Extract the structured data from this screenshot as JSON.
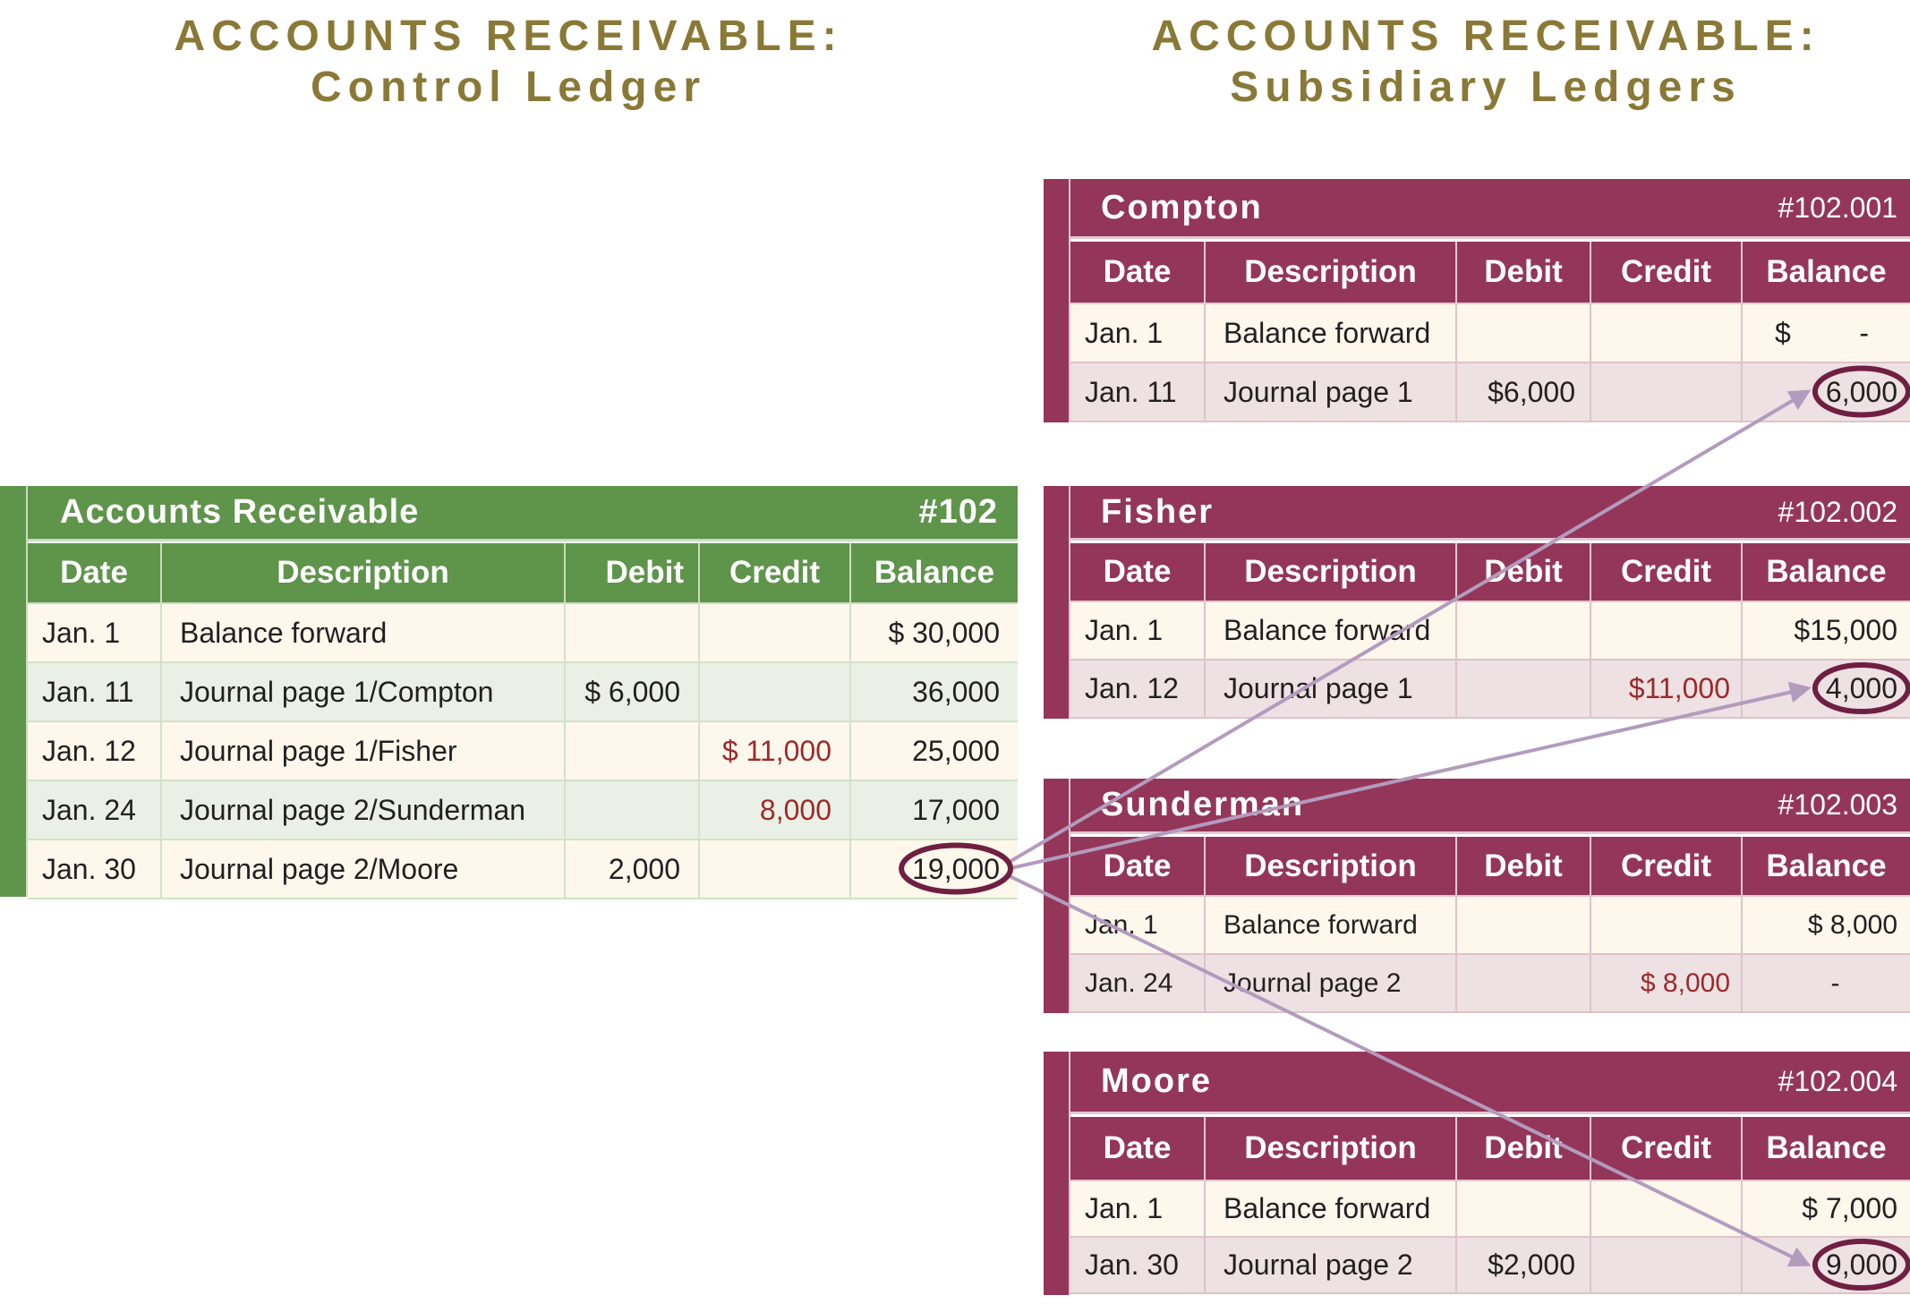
{
  "titles": {
    "control": {
      "line1": "ACCOUNTS RECEIVABLE:",
      "line2": "Control Ledger"
    },
    "subsidiary": {
      "line1": "ACCOUNTS RECEIVABLE:",
      "line2": "Subsidiary Ledgers"
    }
  },
  "columns": [
    "Date",
    "Description",
    "Debit",
    "Credit",
    "Balance"
  ],
  "colors": {
    "title": "#8a7936",
    "control_header": "#5f944b",
    "subsidiary_header": "#93365a",
    "credit_text": "#9b2a2a",
    "highlight_oval": "#6f1f42",
    "connector_arrow": "#b39bbd"
  },
  "control_ledger": {
    "name": "Accounts Receivable",
    "account": "#102",
    "rows": [
      {
        "date": "Jan. 1",
        "description": "Balance forward",
        "debit": "",
        "credit": "",
        "balance": "$  30,000"
      },
      {
        "date": "Jan. 11",
        "description": "Journal page 1/Compton",
        "debit": "$  6,000",
        "credit": "",
        "balance": "36,000"
      },
      {
        "date": "Jan. 12",
        "description": "Journal page 1/Fisher",
        "debit": "",
        "credit": "$  11,000",
        "balance": "25,000"
      },
      {
        "date": "Jan. 24",
        "description": "Journal page 2/Sunderman",
        "debit": "",
        "credit": "8,000",
        "balance": "17,000"
      },
      {
        "date": "Jan. 30",
        "description": "Journal page 2/Moore",
        "debit": "2,000",
        "credit": "",
        "balance": "19,000",
        "highlighted": true
      }
    ]
  },
  "subsidiary_ledgers": [
    {
      "name": "Compton",
      "account": "#102.001",
      "rows": [
        {
          "date": "Jan. 1",
          "description": "Balance forward",
          "debit": "",
          "credit": "",
          "balance_symbol": "$",
          "balance": "-"
        },
        {
          "date": "Jan. 11",
          "description": "Journal page 1",
          "debit": "$6,000",
          "credit": "",
          "balance": "6,000",
          "highlighted": true
        }
      ]
    },
    {
      "name": "Fisher",
      "account": "#102.002",
      "rows": [
        {
          "date": "Jan. 1",
          "description": "Balance forward",
          "debit": "",
          "credit": "",
          "balance": "$15,000"
        },
        {
          "date": "Jan. 12",
          "description": "Journal page 1",
          "debit": "",
          "credit": "$11,000",
          "balance": "4,000",
          "highlighted": true
        }
      ]
    },
    {
      "name": "Sunderman",
      "account": "#102.003",
      "rows": [
        {
          "date": "Jan. 1",
          "description": "Balance forward",
          "debit": "",
          "credit": "",
          "balance": "$  8,000"
        },
        {
          "date": "Jan. 24",
          "description": "Journal page 2",
          "debit": "",
          "credit": "$  8,000",
          "balance": "-"
        }
      ]
    },
    {
      "name": "Moore",
      "account": "#102.004",
      "rows": [
        {
          "date": "Jan. 1",
          "description": "Balance forward",
          "debit": "",
          "credit": "",
          "balance": "$  7,000"
        },
        {
          "date": "Jan. 30",
          "description": "Journal page 2",
          "debit": "$2,000",
          "credit": "",
          "balance": "9,000",
          "highlighted": true
        }
      ]
    }
  ],
  "connections": [
    {
      "from": "control_ledger.balance.19,000",
      "to": "Compton.balance.6,000"
    },
    {
      "from": "control_ledger.balance.19,000",
      "to": "Fisher.balance.4,000"
    },
    {
      "from": "control_ledger.balance.19,000",
      "to": "Moore.balance.9,000"
    }
  ]
}
